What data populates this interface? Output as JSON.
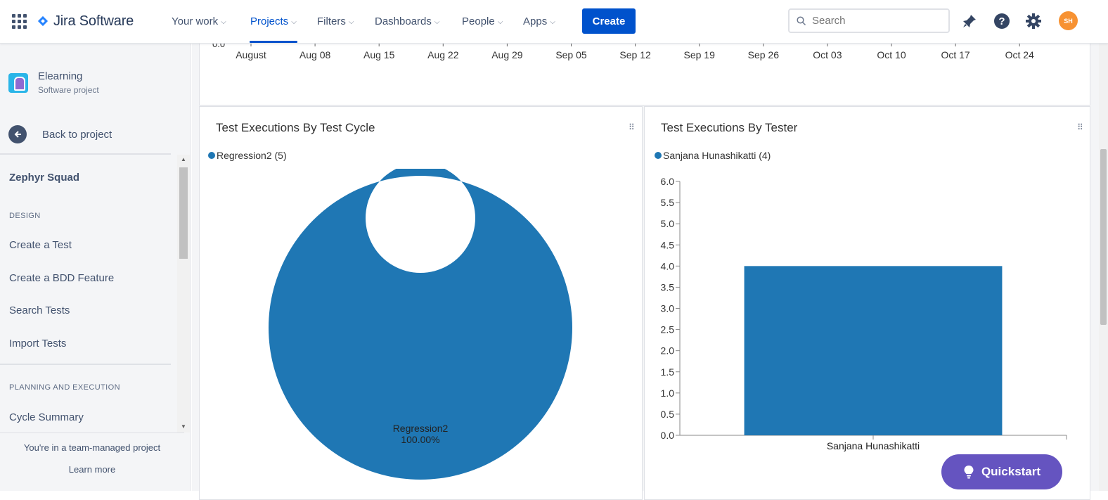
{
  "nav": {
    "logo": "Jira Software",
    "items": [
      {
        "label": "Your work"
      },
      {
        "label": "Projects"
      },
      {
        "label": "Filters"
      },
      {
        "label": "Dashboards"
      },
      {
        "label": "People"
      },
      {
        "label": "Apps"
      }
    ],
    "active_item": "Projects",
    "create_label": "Create",
    "search_placeholder": "Search",
    "avatar_initials": "SH"
  },
  "sidebar": {
    "project_name": "Elearning",
    "project_type": "Software project",
    "back_label": "Back to project",
    "app_name": "Zephyr Squad",
    "sections": [
      {
        "title": "DESIGN",
        "items": [
          "Create a Test",
          "Create a BDD Feature",
          "Search Tests",
          "Import Tests"
        ]
      },
      {
        "title": "PLANNING AND EXECUTION",
        "items": [
          "Cycle Summary"
        ]
      }
    ],
    "footer_text": "You're in a team-managed project",
    "footer_link": "Learn more"
  },
  "timeline": {
    "clipped_tick": "0.0",
    "x_ticks": [
      "August",
      "Aug 08",
      "Aug 15",
      "Aug 22",
      "Aug 29",
      "Sep 05",
      "Sep 12",
      "Sep 19",
      "Sep 26",
      "Oct 03",
      "Oct 10",
      "Oct 17",
      "Oct 24"
    ]
  },
  "gadgets": {
    "by_cycle": {
      "title": "Test Executions By Test Cycle",
      "legend": "Regression2 (5)"
    },
    "by_tester": {
      "title": "Test Executions By Tester",
      "legend": "Sanjana Hunashikatti (4)"
    }
  },
  "chart_data": [
    {
      "type": "pie",
      "title": "Test Executions By Test Cycle",
      "categories": [
        "Regression2"
      ],
      "values": [
        5
      ],
      "slice_label": "Regression2",
      "slice_percent": "100.00%",
      "donut": true,
      "legend": "top-left",
      "color": "#1F77B4"
    },
    {
      "type": "bar",
      "title": "Test Executions By Tester",
      "categories": [
        "Sanjana Hunashikatti"
      ],
      "values": [
        4
      ],
      "ylim": [
        0,
        6
      ],
      "y_ticks": [
        "0.0",
        "0.5",
        "1.0",
        "1.5",
        "2.0",
        "2.5",
        "3.0",
        "3.5",
        "4.0",
        "4.5",
        "5.0",
        "5.5",
        "6.0"
      ],
      "legend": "top-left",
      "grid": false,
      "color": "#1F77B4"
    }
  ],
  "quickstart_label": "Quickstart"
}
